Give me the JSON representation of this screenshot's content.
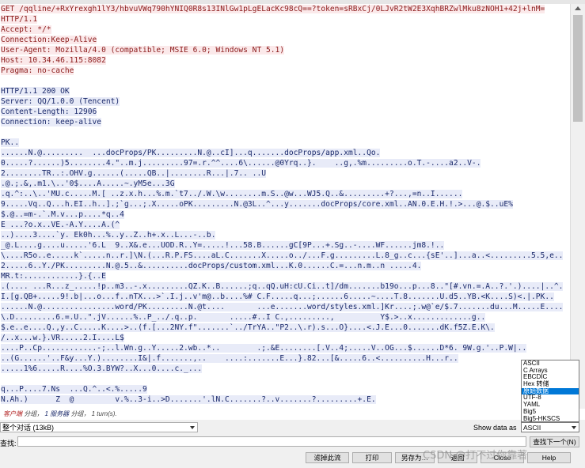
{
  "request_lines": [
    "GET /qqline/+RxYrexgh1lY3/hbvuVWq790hYNIQ0R8s13INlGw1pLgELacKc98cQ==?token=sRBxCj/0LJvR2tW2E3XqhBRZwlMku8zNOH1+42j+lnM=",
    "HTTP/1.1",
    "Accept: */*",
    "Connection:Keep-Alive",
    "User-Agent: Mozilla/4.0 (compatible; MSIE 6.0; Windows NT 5.1)",
    "Host: 10.34.46.115:8082",
    "Pragma: no-cache"
  ],
  "response_lines": [
    "HTTP/1.1 200 OK",
    "Server: QQ/1.0.0 (Tencent)",
    "Content-Length: 12906",
    "Connection: keep-alive"
  ],
  "body_lines": [
    "PK..",
    "......N.@.........  ...docProps/PK.........N.@..cI]...q.......docProps/app.xml..Qo.",
    "0.....?......)5........4.\"..m.j.........97=.r.^^....6\\......@0Yrq..}.    ..g,.%m.........o.T.-....a2..V-.",
    "2........TR..:.OHV.g......(.....QB..|........R...|.7.. ..U",
    ".@.;.&,.m1.\\..'0$....A.....~.yM5e...3G",
    ".q.^:..\\..'MU.c.....M.[ ..z.x.h...%.m.`t7../.W.\\w........m.S..@w...WJ5.Q..&.........+?...,=n..I......",
    "9.....Vq..Q...h.EI..h..].;`g...;.X.....oPK.........N.@3L..^...y.......docProps/core.xml..AN.0.E.H.!.>...@.$..uE%",
    "$.@..=m-.`.M.v...p....*q..4",
    "E ...?o.x..VE.-A.Y....A.(^",
    "..)....3....`y. Ek0h...%..y..Z..h+.x..L...-..b.",
    "_@.L....g....u.....'6.L  9..X&.e...UOD.R..Y=.....!...58.B......gC[9P...+.Sg..-....WF......jm8.!..",
    "\\....R5o..e.....k`.....n..r.]\\N.(...R.P.FS....aL.C.......X.....o../...F.g.........L.8_g..c...{sE'..]...a..<.........5.5,e..",
    "2.....6..Y./PK.........N.@.5..&..........docProps/custom.xml...K.0......C.=...n.m..n .....4.",
    "MR.t:............}.{..E",
    ".(.... ...R...z_.....!p..m3..-.x.........QZ.K..B......;q..qQ.uH:cU.Ci..t]/dm.......b19o...p...8..\"[#.vn.=.A..?.'.)....|..^.",
    "I.[g.QB+.....9!.b|...o...f..nTX...>`.I.j..v'm@..b....%# C.F.....q...;......6.....~....T.8.......U.d5..YB.<K....S)<.|.PK..",
    "......N.@................word/PK.........N.@t....       ...e.......word/styles.xml.]Kr....;.w@`e/$.7.......du...M.....E....",
    "\\.D.........6.=.U..\".jV......%..P_../.q..p.       .....#..I C.,.........,          Y$.>..x.............g..",
    "$.e..e....Q.,y..C.....K....>..(f.[...2NY.f\".......`../TrYA..\"P2..\\.r).s...O}....<.J.E...0.......dK.f5Z.E.K\\.",
    "/..x...w.}.VR.....2.I....L$",
    "....P..Cp............-;..l.Wn.g..Y.....2.wb..*..        .;.&E........[.V..4;.....V..OG...$......D*6. 9W.g.'..P.W|..",
    "..(G......'..F&y...Y.)........I&|.f.......,..    ....:.......E...}.82...[&.....6..<..........H...r..",
    ".....1%6.....R....%O.3.BYW?..X...0....c._...",
    "",
    "q...P....7.Ns  ...Q.^..<.%.....9",
    "N.Ah.)      Z  @         v.%..3-i..>D.......'.lN.C.......?..v.......?.........+.E."
  ],
  "status": {
    "client": "客户端",
    "client_count": "分组，",
    "server_label": "1 服务器",
    "server_count": "分组，",
    "turns": "1 turn(s)."
  },
  "conversation_select": "整个对话 (13kB)",
  "show_data_label": "Show data as",
  "show_data_value": "ASCII",
  "show_data_options": [
    "ASCII",
    "C Arrays",
    "EBCDIC",
    "Hex 转储",
    "原始数据",
    "UTF-8",
    "YAML",
    "Big5",
    "Big5-HKSCS"
  ],
  "show_data_selected_index": 4,
  "find_label": "查找:",
  "find_next_label": "查找下一个(N)",
  "buttons": {
    "filter_out": "滤掉此流",
    "print": "打印",
    "save_as": "另存为…",
    "back": "返回",
    "close": "Close",
    "help": "Help"
  },
  "watermark": "CSDN @打不过你靠著",
  "colors": {
    "request_text": "#8b1a1a",
    "request_bg": "#fbe9ea",
    "response_text": "#1b2a6b",
    "response_bg": "#e8ebf8",
    "selected": "#0078d7"
  }
}
